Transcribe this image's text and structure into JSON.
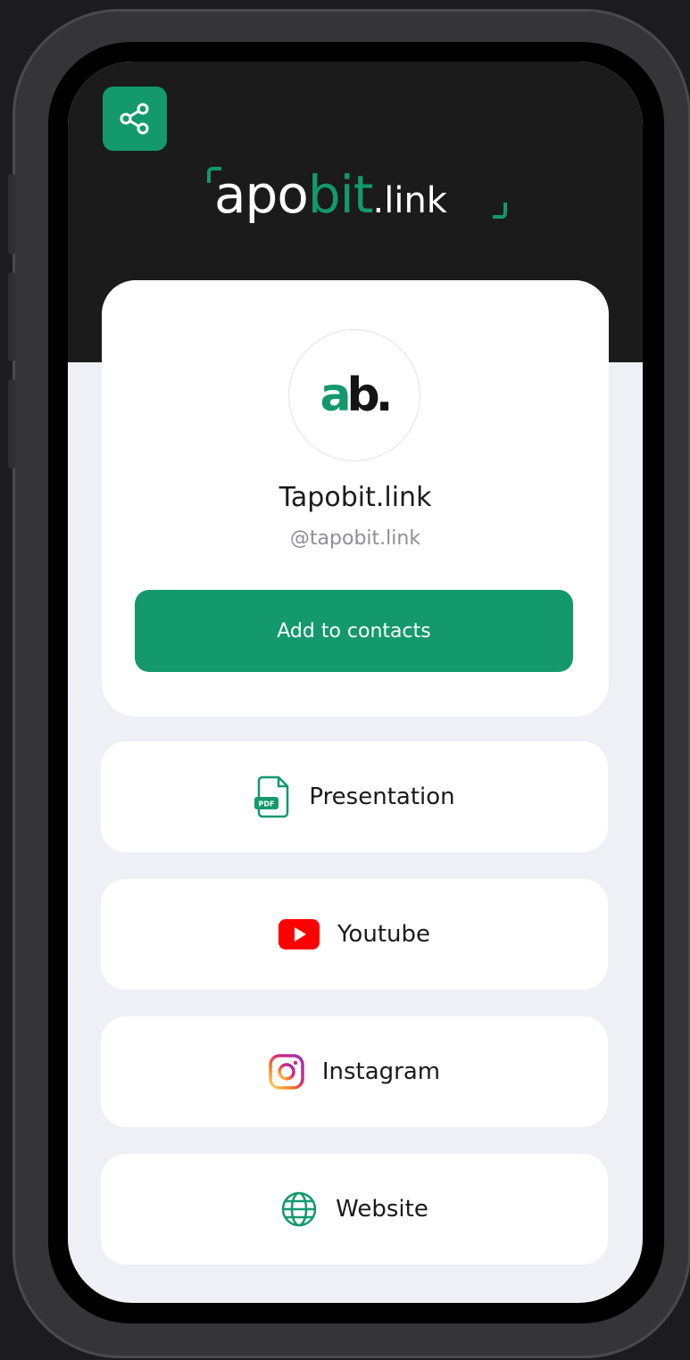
{
  "brand": {
    "logo_part1": "apo",
    "logo_part2": "bit",
    "logo_part3": ".link",
    "accent_color": "#13996b"
  },
  "share": {
    "icon": "share-icon"
  },
  "profile": {
    "avatar_letter_a": "a",
    "avatar_letter_b": "b.",
    "name": "Tapobit.link",
    "handle": "@tapobit.link",
    "add_button_label": "Add to contacts"
  },
  "links": [
    {
      "label": "Presentation",
      "icon": "pdf-file-icon"
    },
    {
      "label": "Youtube",
      "icon": "youtube-icon"
    },
    {
      "label": "Instagram",
      "icon": "instagram-icon"
    },
    {
      "label": "Website",
      "icon": "globe-icon"
    }
  ]
}
